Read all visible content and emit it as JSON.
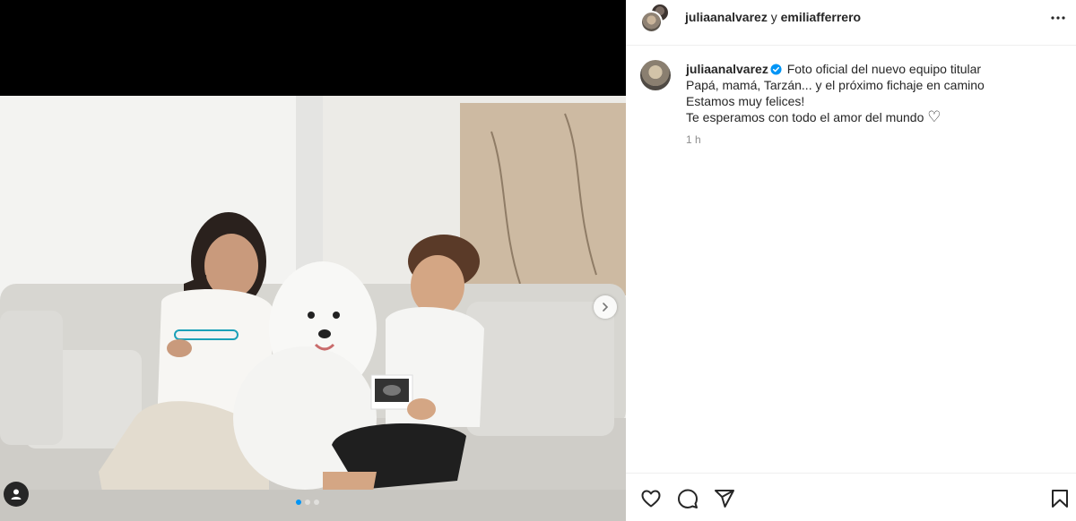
{
  "header": {
    "user1": "juliaanalvarez",
    "joiner": " y ",
    "user2": "emiliafferrero"
  },
  "caption": {
    "username": "juliaanalvarez",
    "lines": [
      "Foto oficial del nuevo equipo titular",
      "Papá, mamá, Tarzán... y el próximo fichaje en camino",
      "Estamos muy felices!",
      "Te esperamos con todo el amor del mundo"
    ],
    "heart_emoji": "♡",
    "time": "1 h"
  },
  "carousel": {
    "current": 1,
    "total": 3
  },
  "colors": {
    "accent": "#0095f6",
    "text": "#262626",
    "muted": "#8e8e8e",
    "divider": "#efefef"
  },
  "icons": [
    "more-icon",
    "verified-icon",
    "chevron-right-icon",
    "person-tag-icon",
    "heart-icon",
    "comment-icon",
    "share-icon",
    "bookmark-icon"
  ]
}
